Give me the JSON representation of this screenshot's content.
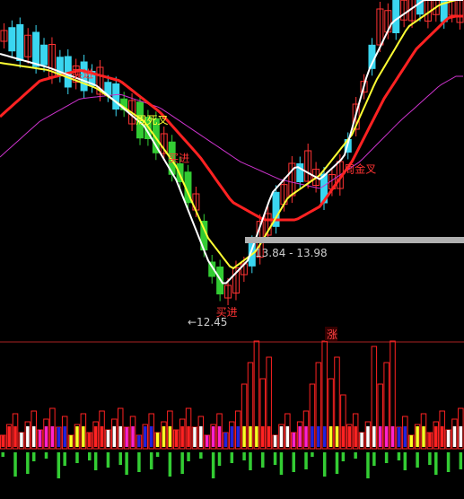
{
  "colors": {
    "background": "#000000",
    "candle_up": "#ff3333",
    "candle_down": "#3ad6f0",
    "candle_green": "#33cc33",
    "ma_white": "#ffffff",
    "ma_yellow": "#ffff33",
    "ma_red": "#ff2222",
    "ma_purple": "#cc33cc",
    "divider": "#cc2222",
    "gray_band": "#b0b0b0"
  },
  "chart_data": [
    {
      "type": "candlestick",
      "annotations": [
        {
          "text": "买进",
          "color": "#ff3333",
          "x_index": 9
        },
        {
          "text": "周死叉",
          "color": "#ffff33",
          "x_index": 17
        },
        {
          "text": "买进",
          "color": "#ff3333",
          "x_index": 21
        },
        {
          "text": "买进",
          "color": "#ff3333",
          "x_index": 27
        },
        {
          "text": "周金叉",
          "color": "#ff3333",
          "x_index": 43
        }
      ],
      "range_label": "13.84 - 13.98",
      "low_marker": "←12.45",
      "low_value": 12.45,
      "range_low": 13.84,
      "range_high": 13.98
    },
    {
      "type": "bar",
      "panel_label": "涨"
    }
  ]
}
